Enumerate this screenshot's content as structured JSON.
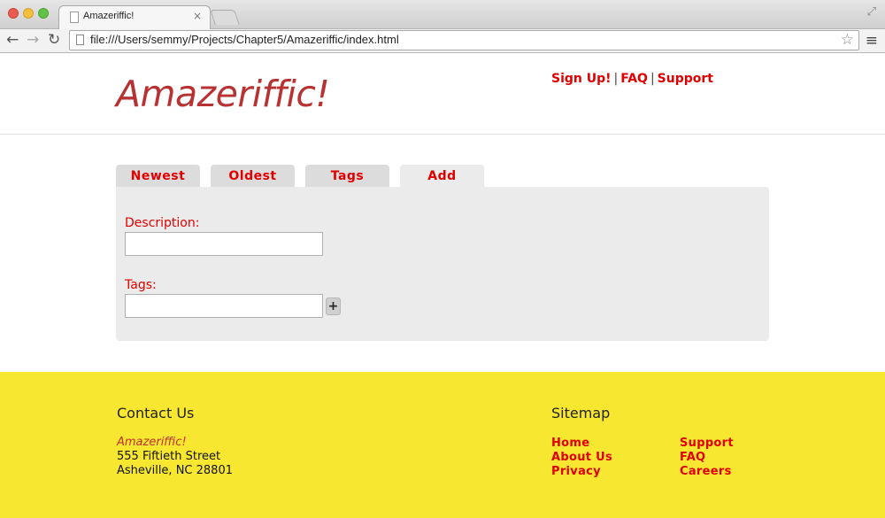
{
  "browser": {
    "tab_title": "Amazeriffic!",
    "tab_close": "×",
    "url": "file:///Users/semmy/Projects/Chapter5/Amazeriffic/index.html",
    "icons": {
      "back": "arrow-left-icon",
      "forward": "arrow-right-icon",
      "reload": "reload-icon",
      "star": "star-icon",
      "menu": "menu-icon",
      "fullscreen": "fullscreen-icon"
    }
  },
  "header": {
    "logo": "Amazeriffic!",
    "nav": {
      "signup": "Sign Up!",
      "separator": "|",
      "faq": "FAQ",
      "support": "Support"
    }
  },
  "main": {
    "tabs": [
      {
        "label": "Newest"
      },
      {
        "label": "Oldest"
      },
      {
        "label": "Tags"
      },
      {
        "label": "Add",
        "active": true
      }
    ],
    "form": {
      "description_label": "Description:",
      "description_value": "",
      "tags_label": "Tags:",
      "tags_value": "",
      "add_button": "+"
    }
  },
  "footer": {
    "contact_heading": "Contact Us",
    "address": {
      "company": "Amazeriffic!",
      "street": "555 Fiftieth Street",
      "city": "Asheville, NC 28801"
    },
    "sitemap_heading": "Sitemap",
    "sitemap_links": [
      "Home",
      "About Us",
      "Privacy",
      "Support",
      "FAQ",
      "Careers"
    ]
  },
  "colors": {
    "link_red": "#e00000",
    "logo_red": "#b83232",
    "footer_yellow": "#f8e731",
    "panel_gray": "#ebebeb",
    "tab_gray": "#dcdcdc"
  }
}
